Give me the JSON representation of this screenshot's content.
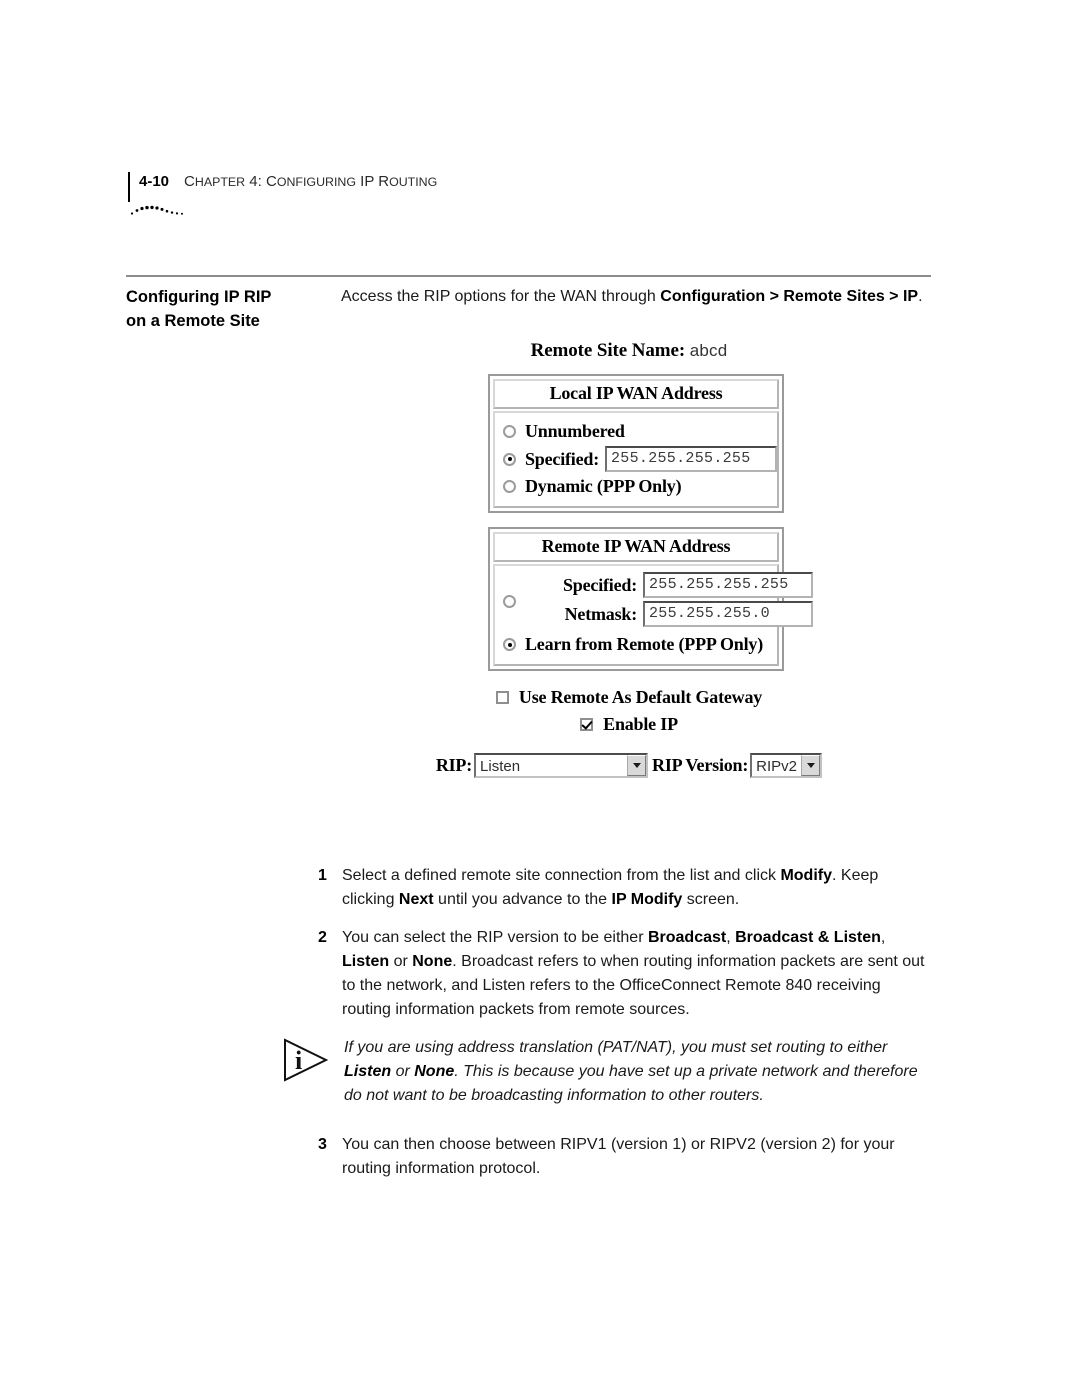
{
  "header": {
    "folio": "4-10",
    "chapter_label_first": "C",
    "chapter_label_rest": "HAPTER",
    "chapter_number": " 4: C",
    "chapter_title_rest": "ONFIGURING",
    "chapter_title_ip": " IP R",
    "chapter_title_routing": "OUTING",
    "full_chapter_title": "CHAPTER 4: CONFIGURING IP ROUTING"
  },
  "section": {
    "heading_line1": "Configuring IP RIP",
    "heading_line2": "on a Remote Site",
    "intro_part1": "Access the RIP options for the WAN through ",
    "intro_bold1": "Configuration > Remote Sites > IP",
    "intro_part2": "."
  },
  "screen": {
    "remote_site_name_label": "Remote Site Name:",
    "remote_site_name_value": "abcd",
    "local_group": {
      "title": "Local IP WAN Address",
      "options": [
        {
          "label": "Unnumbered",
          "selected": false
        },
        {
          "label": "Specified:",
          "selected": true,
          "value": "255.255.255.255"
        },
        {
          "label": "Dynamic (PPP Only)",
          "selected": false
        }
      ]
    },
    "remote_group": {
      "title": "Remote IP WAN Address",
      "specified_label": "Specified:",
      "specified_value": "255.255.255.255",
      "specified_selected": false,
      "netmask_label": "Netmask:",
      "netmask_value": "255.255.255.0",
      "learn_label": "Learn from Remote (PPP Only)",
      "learn_selected": true
    },
    "checkboxes": [
      {
        "label": "Use Remote As Default Gateway",
        "checked": false
      },
      {
        "label": "Enable IP",
        "checked": true
      }
    ],
    "rip_label": "RIP:",
    "rip_value": "Listen",
    "rip_version_label": "RIP Version:",
    "rip_version_value": "RIPv2"
  },
  "steps": [
    {
      "num": "1",
      "p1": "Select a defined remote site connection from the list and click ",
      "b1": "Modify",
      "p2": ". Keep clicking ",
      "b2": "Next",
      "p3": " until you advance to the ",
      "b3": "IP Modify",
      "p4": " screen."
    },
    {
      "num": "2",
      "p1": "You can select the RIP version to be either ",
      "b1": "Broadcast",
      "p2": ", ",
      "b2": "Broadcast & Listen",
      "p3": ", ",
      "b3": "Listen",
      "p4": " or ",
      "b4": "None",
      "p5": ". Broadcast refers to when routing information packets are sent out to the network, and Listen refers to the OfficeConnect Remote 840 receiving routing information packets from remote sources."
    }
  ],
  "note": {
    "p1": "If you are using address translation (PAT/NAT), you must set routing to either ",
    "b1": "Listen",
    "p2": " or ",
    "b2": "None",
    "p3": ". This is because you have set up a private network and therefore do not want to be broadcasting information to other routers."
  },
  "step3": {
    "num": "3",
    "text": "You can then choose between RIPV1 (version 1) or RIPV2 (version 2) for your routing information protocol."
  }
}
